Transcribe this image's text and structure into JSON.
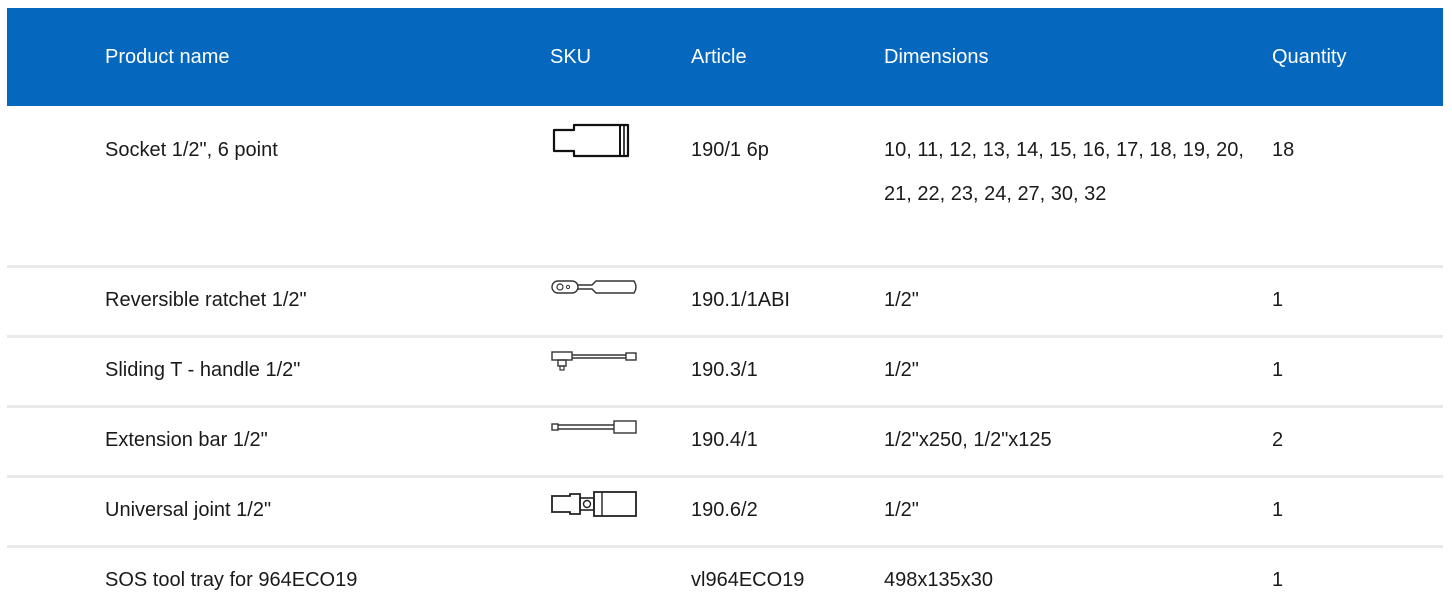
{
  "table": {
    "headers": {
      "product_name": "Product name",
      "sku": "SKU",
      "article": "Article",
      "dimensions": "Dimensions",
      "quantity": "Quantity"
    },
    "rows": [
      {
        "product_name": "Socket 1/2\", 6 point",
        "sku_icon": "socket-icon",
        "article": "190/1 6p",
        "dimensions": "10, 11, 12, 13, 14, 15, 16, 17, 18, 19, 20, 21, 22, 23, 24, 27, 30, 32",
        "quantity": "18"
      },
      {
        "product_name": "Reversible ratchet 1/2\"",
        "sku_icon": "ratchet-icon",
        "article": "190.1/1ABI",
        "dimensions": "1/2\"",
        "quantity": "1"
      },
      {
        "product_name": "Sliding T - handle 1/2\"",
        "sku_icon": "t-handle-icon",
        "article": "190.3/1",
        "dimensions": "1/2\"",
        "quantity": "1"
      },
      {
        "product_name": "Extension bar 1/2\"",
        "sku_icon": "extension-bar-icon",
        "article": "190.4/1",
        "dimensions": "1/2\"x250, 1/2\"x125",
        "quantity": "2"
      },
      {
        "product_name": "Universal joint 1/2\"",
        "sku_icon": "universal-joint-icon",
        "article": "190.6/2",
        "dimensions": "1/2\"",
        "quantity": "1"
      },
      {
        "product_name": "SOS tool tray for 964ECO19",
        "sku_icon": "",
        "article": "vl964ECO19",
        "dimensions": "498x135x30",
        "quantity": "1"
      }
    ]
  },
  "colors": {
    "header_bg": "#0567bd",
    "header_text": "#ffffff",
    "row_divider": "#e9e9e9"
  }
}
